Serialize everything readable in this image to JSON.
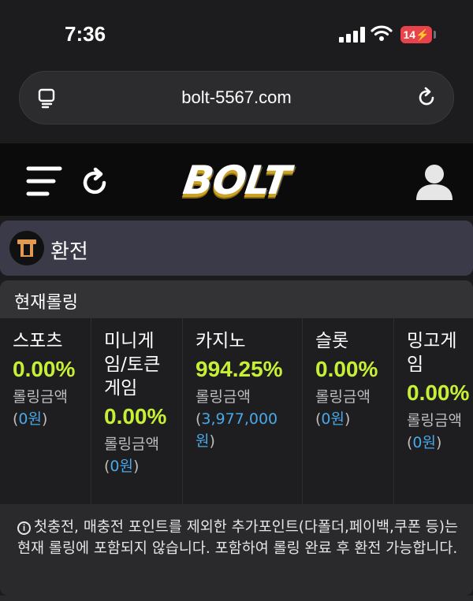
{
  "status": {
    "time": "7:36",
    "battery": "14"
  },
  "browser": {
    "url": "bolt-5567.com"
  },
  "site": {
    "logo": "BOLT"
  },
  "exchange": {
    "label": "환전"
  },
  "rolling": {
    "title": "현재롤링",
    "amount_label": "롤링금액",
    "columns": [
      {
        "name": "스포츠",
        "percent": "0.00%",
        "amount": "0원"
      },
      {
        "name": "미니게임/토큰게임",
        "percent": "0.00%",
        "amount": "0원"
      },
      {
        "name": "카지노",
        "percent": "994.25%",
        "amount": "3,977,000원"
      },
      {
        "name": "슬롯",
        "percent": "0.00%",
        "amount": "0원"
      },
      {
        "name": "밍고게임",
        "percent": "0.00%",
        "amount": "0원"
      }
    ],
    "notice": "첫충전, 매충전 포인트를 제외한 추가포인트(다폴더,페이백,쿠폰 등)는 현재 롤링에 포함되지 않습니다. 포함하여 롤링 완료 후 환전 가능합니다."
  },
  "colors": {
    "accent_green": "#c6f035",
    "link_blue": "#4aa8e8",
    "battery_red": "#e8434b"
  }
}
